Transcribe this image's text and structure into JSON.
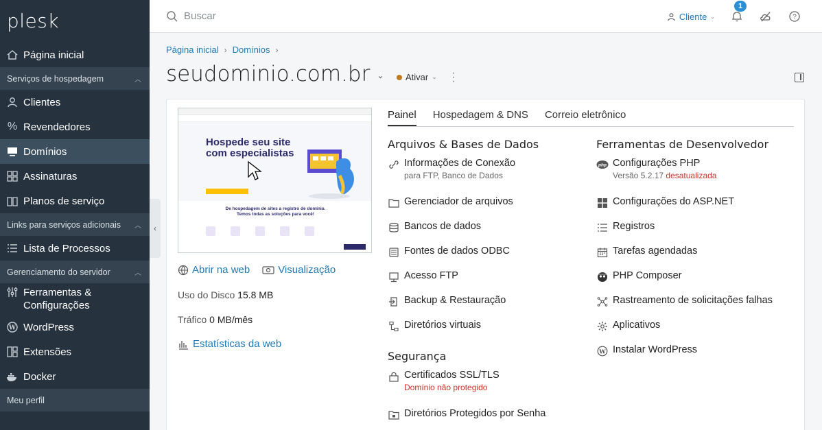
{
  "app": {
    "logo": "plesk"
  },
  "sidebar": {
    "items": [
      {
        "label": "Página inicial",
        "icon": "home-icon"
      },
      {
        "group": "Serviços de hospedagem"
      },
      {
        "label": "Clientes",
        "icon": "user-icon"
      },
      {
        "label": "Revendedores",
        "icon": "percent-icon"
      },
      {
        "label": "Domínios",
        "icon": "monitor-icon",
        "active": true
      },
      {
        "label": "Assinaturas",
        "icon": "grid-icon"
      },
      {
        "label": "Planos de serviço",
        "icon": "book-icon"
      },
      {
        "group": "Links para serviços adicionais"
      },
      {
        "label": "Lista de Processos",
        "icon": "list-icon"
      },
      {
        "group": "Gerenciamento do servidor"
      },
      {
        "label": "Ferramentas & Configurações",
        "icon": "sliders-icon"
      },
      {
        "label": "WordPress",
        "icon": "wordpress-icon"
      },
      {
        "label": "Extensões",
        "icon": "extensions-icon"
      },
      {
        "label": "Docker",
        "icon": "docker-icon"
      },
      {
        "group": "Meu perfil"
      }
    ],
    "labels": {
      "home": "Página inicial",
      "group_hosting": "Serviços de hospedagem",
      "clients": "Clientes",
      "resellers": "Revendedores",
      "domains": "Domínios",
      "subscriptions": "Assinaturas",
      "plans": "Planos de serviço",
      "group_links": "Links para serviços adicionais",
      "processes": "Lista de Processos",
      "group_server": "Gerenciamento do servidor",
      "tools_line1": "Ferramentas &",
      "tools_line2": "Configurações",
      "wordpress": "WordPress",
      "extensions": "Extensões",
      "docker": "Docker",
      "group_profile": "Meu perfil"
    }
  },
  "topbar": {
    "search_placeholder": "Buscar",
    "user_label": "Cliente",
    "notifications_count": "1"
  },
  "breadcrumb": {
    "home": "Página inicial",
    "domains": "Domínios"
  },
  "domain": {
    "name": "seudominio.com.br",
    "status": "Ativar"
  },
  "preview_site": {
    "headline_line1": "Hospede seu site",
    "headline_line2": "com especialistas",
    "sub_line1": "De hospedagem de sites a registro de domínio.",
    "sub_line2": "Temos todas as soluções para você!"
  },
  "left_panel": {
    "open_web": "Abrir na web",
    "preview": "Visualização",
    "disk_label": "Uso do Disco",
    "disk_value": "15.8 MB",
    "traffic_label": "Tráfico",
    "traffic_value": "0 MB/mês",
    "web_stats": "Estatísticas da web"
  },
  "tabs": [
    "Painel",
    "Hospedagem & DNS",
    "Correio eletrônico"
  ],
  "files_section": {
    "title": "Arquivos & Bases de Dados",
    "items": [
      {
        "label": "Informações de Conexão",
        "sub": "para FTP, Banco de Dados"
      },
      {
        "label": "Gerenciador de arquivos"
      },
      {
        "label": "Bancos de dados"
      },
      {
        "label": "Fontes de dados ODBC"
      },
      {
        "label": "Acesso FTP"
      },
      {
        "label": "Backup & Restauração"
      },
      {
        "label": "Diretórios virtuais"
      }
    ]
  },
  "security_section": {
    "title": "Segurança",
    "items": [
      {
        "label": "Certificados SSL/TLS",
        "warn": "Domínio não protegido"
      },
      {
        "label": "Diretórios Protegidos por Senha"
      }
    ]
  },
  "dev_section": {
    "title": "Ferramentas de Desenvolvedor",
    "items": [
      {
        "label": "Configurações PHP",
        "sub": "Versão 5.2.17",
        "warn": "desatualizada"
      },
      {
        "label": "Configurações do ASP.NET"
      },
      {
        "label": "Registros"
      },
      {
        "label": "Tarefas agendadas"
      },
      {
        "label": "PHP Composer"
      },
      {
        "label": "Rastreamento de solicitações falhas"
      },
      {
        "label": "Aplicativos"
      },
      {
        "label": "Instalar WordPress"
      }
    ]
  },
  "colors": {
    "sidebar_bg": "#26333f",
    "sidebar_active": "#3c4f5f",
    "link_blue": "#1f7ab8",
    "warning_red": "#c9312a",
    "status_dot": "#c07a22"
  }
}
